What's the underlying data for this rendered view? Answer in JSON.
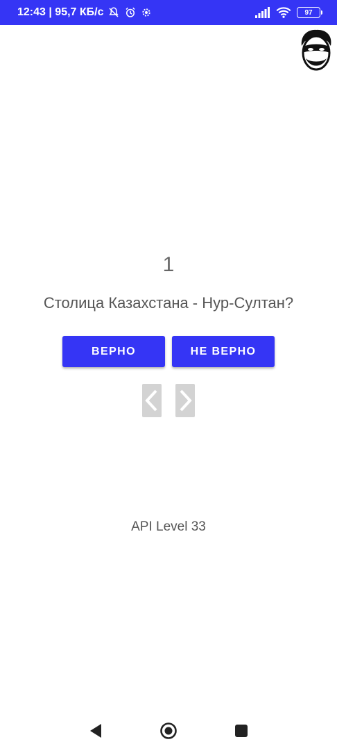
{
  "status_bar": {
    "time_info": "12:43 | 95,7 КБ/с",
    "battery_level": "97",
    "icons": [
      "mute-notifications-icon",
      "alarm-icon",
      "settings-icon",
      "signal-icon",
      "wifi-icon",
      "battery-icon"
    ]
  },
  "quiz": {
    "question_number": "1",
    "question_text": "Столица Казахстана - Нур-Султан?",
    "true_label": "ВЕРНО",
    "false_label": "НЕ ВЕРНО"
  },
  "footer": {
    "api_level": "API Level 33"
  },
  "colors": {
    "accent": "#3535f5",
    "text": "#555555",
    "disabled": "#d3d3d3"
  }
}
